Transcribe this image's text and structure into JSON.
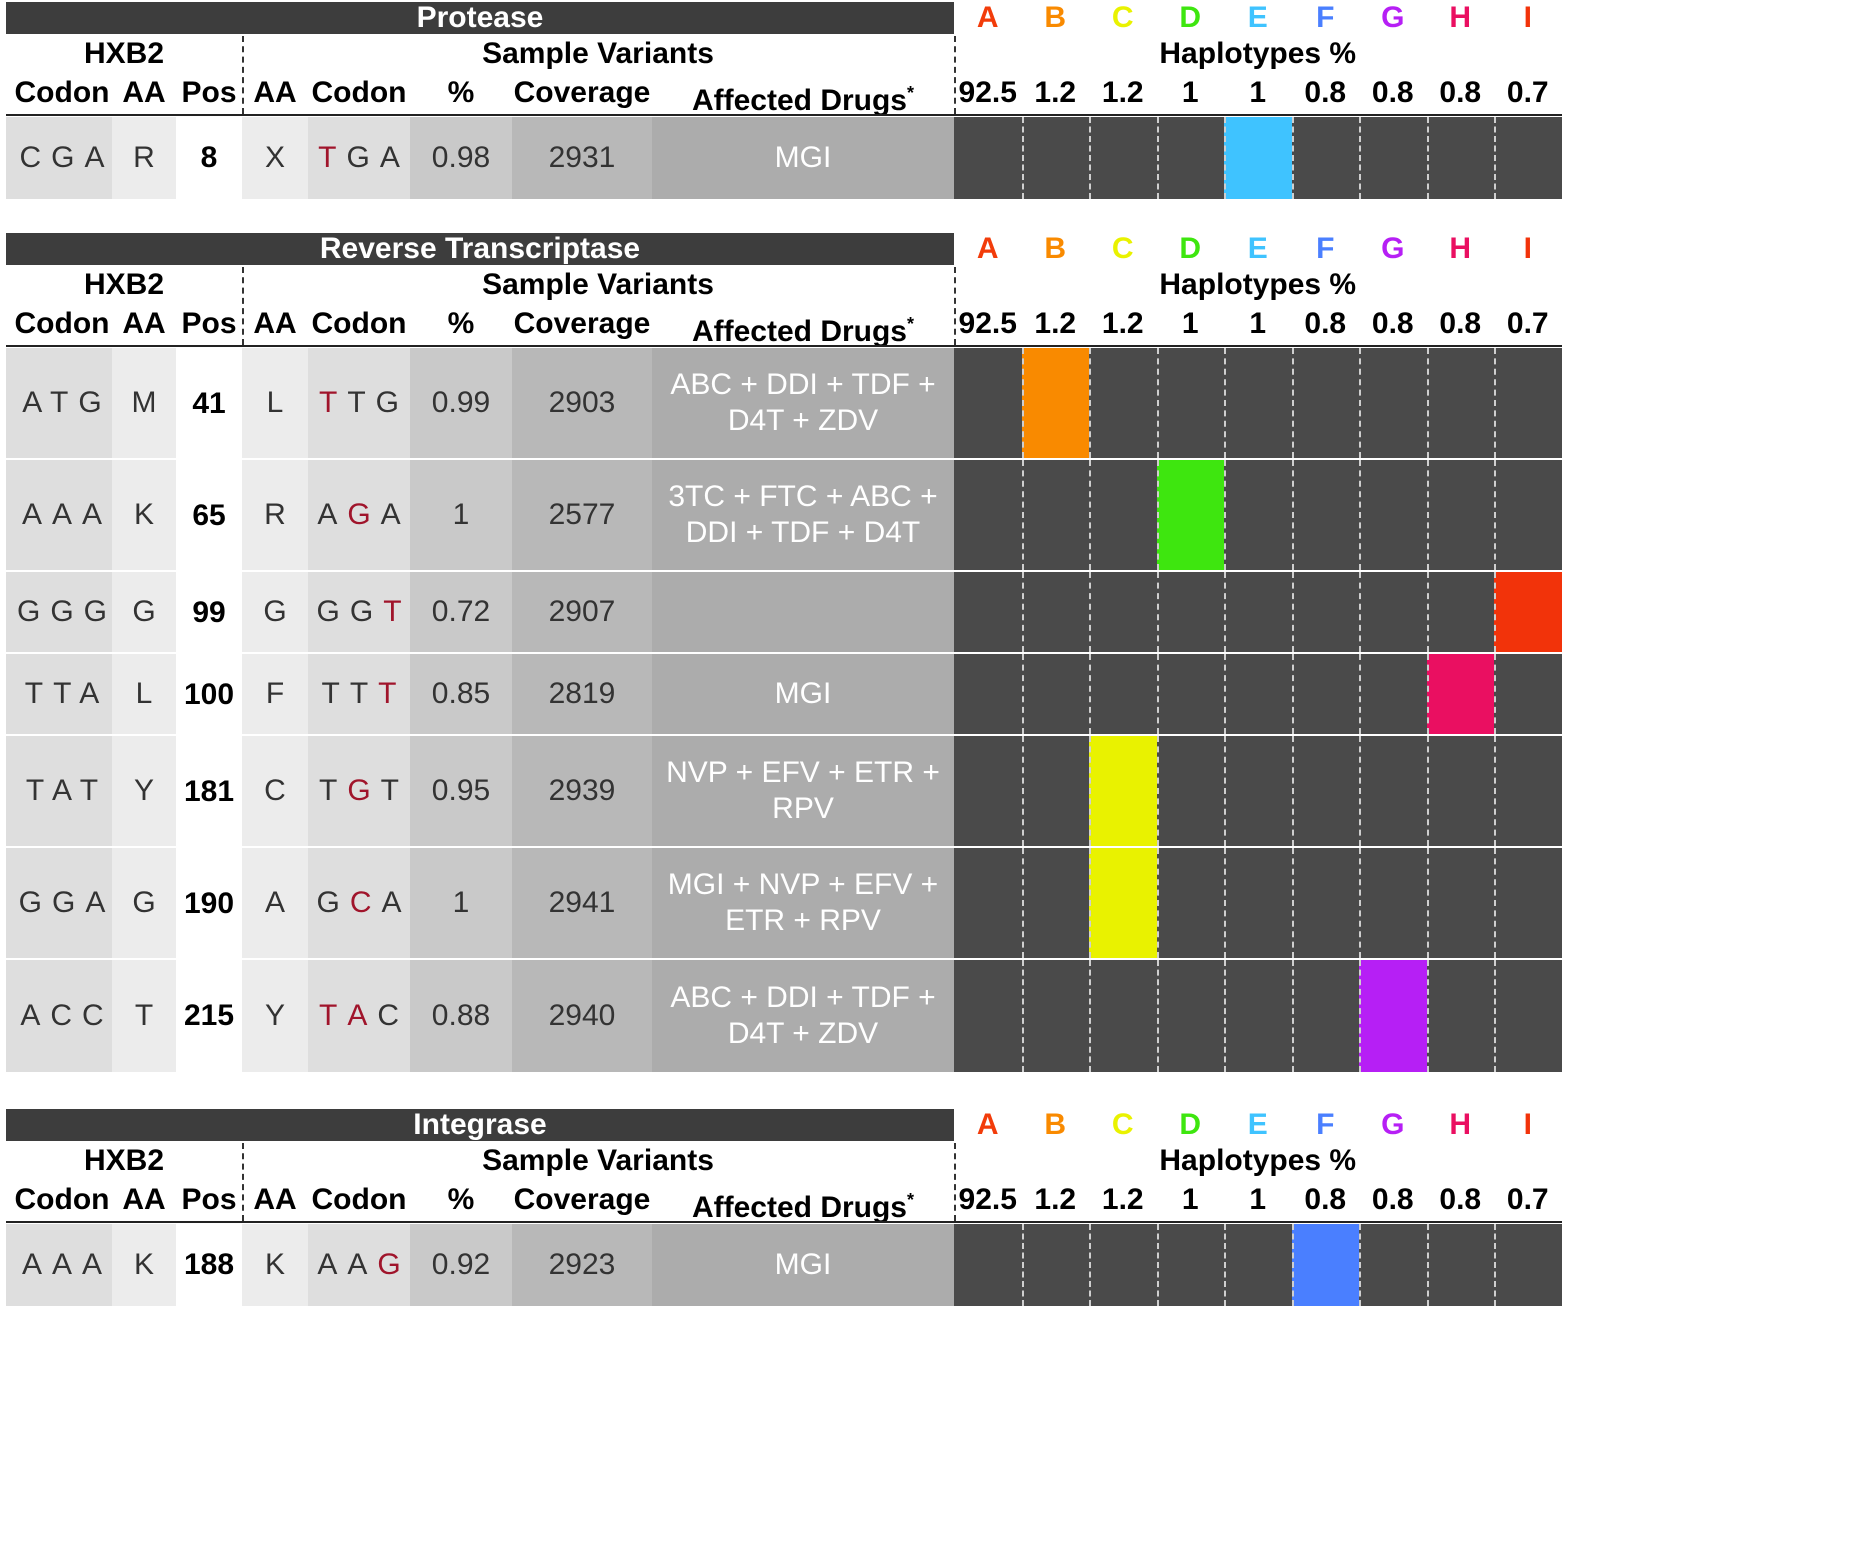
{
  "headers": {
    "hxb2": "HXB2",
    "sample_variants": "Sample Variants",
    "haplotypes": "Haplotypes %",
    "codon": "Codon",
    "aa": "AA",
    "pos": "Pos",
    "pct": "%",
    "coverage": "Coverage",
    "affected_drugs": "Affected Drugs",
    "affected_drugs_mark": "*"
  },
  "haplotypes": [
    {
      "letter": "A",
      "color": "#f23c0a",
      "pct": "92.5"
    },
    {
      "letter": "B",
      "color": "#f98a00",
      "pct": "1.2"
    },
    {
      "letter": "C",
      "color": "#e9f200",
      "pct": "1.2"
    },
    {
      "letter": "D",
      "color": "#3ee60f",
      "pct": "1"
    },
    {
      "letter": "E",
      "color": "#3fc3ff",
      "pct": "1"
    },
    {
      "letter": "F",
      "color": "#4a7fff",
      "pct": "0.8"
    },
    {
      "letter": "G",
      "color": "#b61ff5",
      "pct": "0.8"
    },
    {
      "letter": "H",
      "color": "#ea0f61",
      "pct": "0.8"
    },
    {
      "letter": "I",
      "color": "#f2330a",
      "pct": "0.7"
    }
  ],
  "sections": [
    {
      "title": "Protease",
      "rows": [
        {
          "codon": "CGA",
          "aa": "R",
          "pos": "8",
          "sample_aa": "X",
          "sample_codon": [
            {
              "b": "T",
              "m": true
            },
            {
              "b": "G",
              "m": false
            },
            {
              "b": "A",
              "m": false
            }
          ],
          "pct": "0.98",
          "coverage": "2931",
          "drugs": [
            "MGI"
          ],
          "haplotype": 4
        }
      ]
    },
    {
      "title": "Reverse Transcriptase",
      "rows": [
        {
          "codon": "ATG",
          "aa": "M",
          "pos": "41",
          "sample_aa": "L",
          "sample_codon": [
            {
              "b": "T",
              "m": true
            },
            {
              "b": "T",
              "m": false
            },
            {
              "b": "G",
              "m": false
            }
          ],
          "pct": "0.99",
          "coverage": "2903",
          "drugs": [
            "ABC + DDI + TDF +",
            "D4T + ZDV"
          ],
          "haplotype": 1
        },
        {
          "codon": "AAA",
          "aa": "K",
          "pos": "65",
          "sample_aa": "R",
          "sample_codon": [
            {
              "b": "A",
              "m": false
            },
            {
              "b": "G",
              "m": true
            },
            {
              "b": "A",
              "m": false
            }
          ],
          "pct": "1",
          "coverage": "2577",
          "drugs": [
            "3TC + FTC + ABC +",
            "DDI + TDF + D4T"
          ],
          "haplotype": 3
        },
        {
          "codon": "GGG",
          "aa": "G",
          "pos": "99",
          "sample_aa": "G",
          "sample_codon": [
            {
              "b": "G",
              "m": false
            },
            {
              "b": "G",
              "m": false
            },
            {
              "b": "T",
              "m": true
            }
          ],
          "pct": "0.72",
          "coverage": "2907",
          "drugs": [],
          "haplotype": 8
        },
        {
          "codon": "TTA",
          "aa": "L",
          "pos": "100",
          "sample_aa": "F",
          "sample_codon": [
            {
              "b": "T",
              "m": false
            },
            {
              "b": "T",
              "m": false
            },
            {
              "b": "T",
              "m": true
            }
          ],
          "pct": "0.85",
          "coverage": "2819",
          "drugs": [
            "MGI"
          ],
          "haplotype": 7
        },
        {
          "codon": "TAT",
          "aa": "Y",
          "pos": "181",
          "sample_aa": "C",
          "sample_codon": [
            {
              "b": "T",
              "m": false
            },
            {
              "b": "G",
              "m": true
            },
            {
              "b": "T",
              "m": false
            }
          ],
          "pct": "0.95",
          "coverage": "2939",
          "drugs": [
            "NVP + EFV + ETR +",
            "RPV"
          ],
          "haplotype": 2
        },
        {
          "codon": "GGA",
          "aa": "G",
          "pos": "190",
          "sample_aa": "A",
          "sample_codon": [
            {
              "b": "G",
              "m": false
            },
            {
              "b": "C",
              "m": true
            },
            {
              "b": "A",
              "m": false
            }
          ],
          "pct": "1",
          "coverage": "2941",
          "drugs": [
            "MGI + NVP + EFV +",
            "ETR + RPV"
          ],
          "haplotype": 2
        },
        {
          "codon": "ACC",
          "aa": "T",
          "pos": "215",
          "sample_aa": "Y",
          "sample_codon": [
            {
              "b": "T",
              "m": true
            },
            {
              "b": "A",
              "m": true
            },
            {
              "b": "C",
              "m": false
            }
          ],
          "pct": "0.88",
          "coverage": "2940",
          "drugs": [
            "ABC + DDI + TDF +",
            "D4T + ZDV"
          ],
          "haplotype": 6
        }
      ]
    },
    {
      "title": "Integrase",
      "rows": [
        {
          "codon": "AAA",
          "aa": "K",
          "pos": "188",
          "sample_aa": "K",
          "sample_codon": [
            {
              "b": "A",
              "m": false
            },
            {
              "b": "A",
              "m": false
            },
            {
              "b": "G",
              "m": true
            }
          ],
          "pct": "0.92",
          "coverage": "2923",
          "drugs": [
            "MGI"
          ],
          "haplotype": 5
        }
      ]
    }
  ]
}
